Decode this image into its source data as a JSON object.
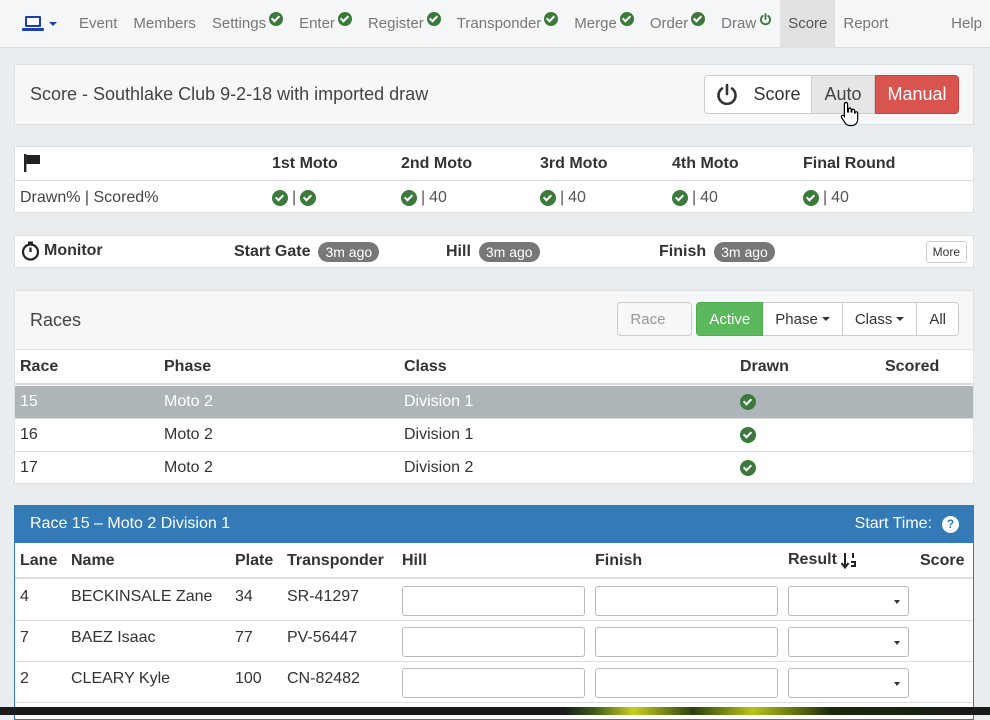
{
  "nav": {
    "items": [
      {
        "label": "Event",
        "checked": false
      },
      {
        "label": "Members",
        "checked": false
      },
      {
        "label": "Settings",
        "checked": true
      },
      {
        "label": "Enter",
        "checked": true
      },
      {
        "label": "Register",
        "checked": true
      },
      {
        "label": "Transponder",
        "checked": true
      },
      {
        "label": "Merge",
        "checked": true
      },
      {
        "label": "Order",
        "checked": true
      },
      {
        "label": "Draw",
        "icon": "power-icon"
      },
      {
        "label": "Score",
        "active": true
      },
      {
        "label": "Report"
      }
    ],
    "help": "Help"
  },
  "header": {
    "title": "Score - Southlake Club 9-2-18 with imported draw",
    "score_btn": "Score",
    "auto_btn": "Auto",
    "manual_btn": "Manual"
  },
  "moto": {
    "columns": [
      "1st Moto",
      "2nd Moto",
      "3rd Moto",
      "4th Moto",
      "Final Round"
    ],
    "row_label": "Drawn% | Scored%",
    "sep": "|",
    "scored": [
      "",
      "40",
      "40",
      "40",
      "40"
    ]
  },
  "monitor": {
    "label": "Monitor",
    "points": [
      {
        "name": "Start Gate",
        "ago": "3m ago"
      },
      {
        "name": "Hill",
        "ago": "3m ago"
      },
      {
        "name": "Finish",
        "ago": "3m ago"
      }
    ],
    "more": "More"
  },
  "races": {
    "title": "Races",
    "search_placeholder": "Race",
    "filters": {
      "active": "Active",
      "phase": "Phase",
      "class": "Class",
      "all": "All"
    },
    "columns": [
      "Race",
      "Phase",
      "Class",
      "Drawn",
      "Scored"
    ],
    "rows": [
      {
        "race": "15",
        "phase": "Moto 2",
        "class": "Division 1",
        "drawn": true
      },
      {
        "race": "16",
        "phase": "Moto 2",
        "class": "Division 1",
        "drawn": true
      },
      {
        "race": "17",
        "phase": "Moto 2",
        "class": "Division 2",
        "drawn": true
      }
    ]
  },
  "detail": {
    "title": "Race 15 – Moto 2 Division 1",
    "start_time": "Start Time:",
    "help": "?",
    "columns": [
      "Lane",
      "Name",
      "Plate",
      "Transponder",
      "Hill",
      "Finish",
      "Result",
      "Score"
    ],
    "riders": [
      {
        "lane": "4",
        "name": "BECKINSALE Zane",
        "plate": "34",
        "transponder": "SR-41297"
      },
      {
        "lane": "7",
        "name": "BAEZ Isaac",
        "plate": "77",
        "transponder": "PV-56447"
      },
      {
        "lane": "2",
        "name": "CLEARY Kyle",
        "plate": "100",
        "transponder": "CN-82482"
      }
    ]
  },
  "colors": {
    "primary": "#337ab7",
    "success": "#5cb85c",
    "danger": "#d9534f",
    "check": "#3b7a3b"
  }
}
